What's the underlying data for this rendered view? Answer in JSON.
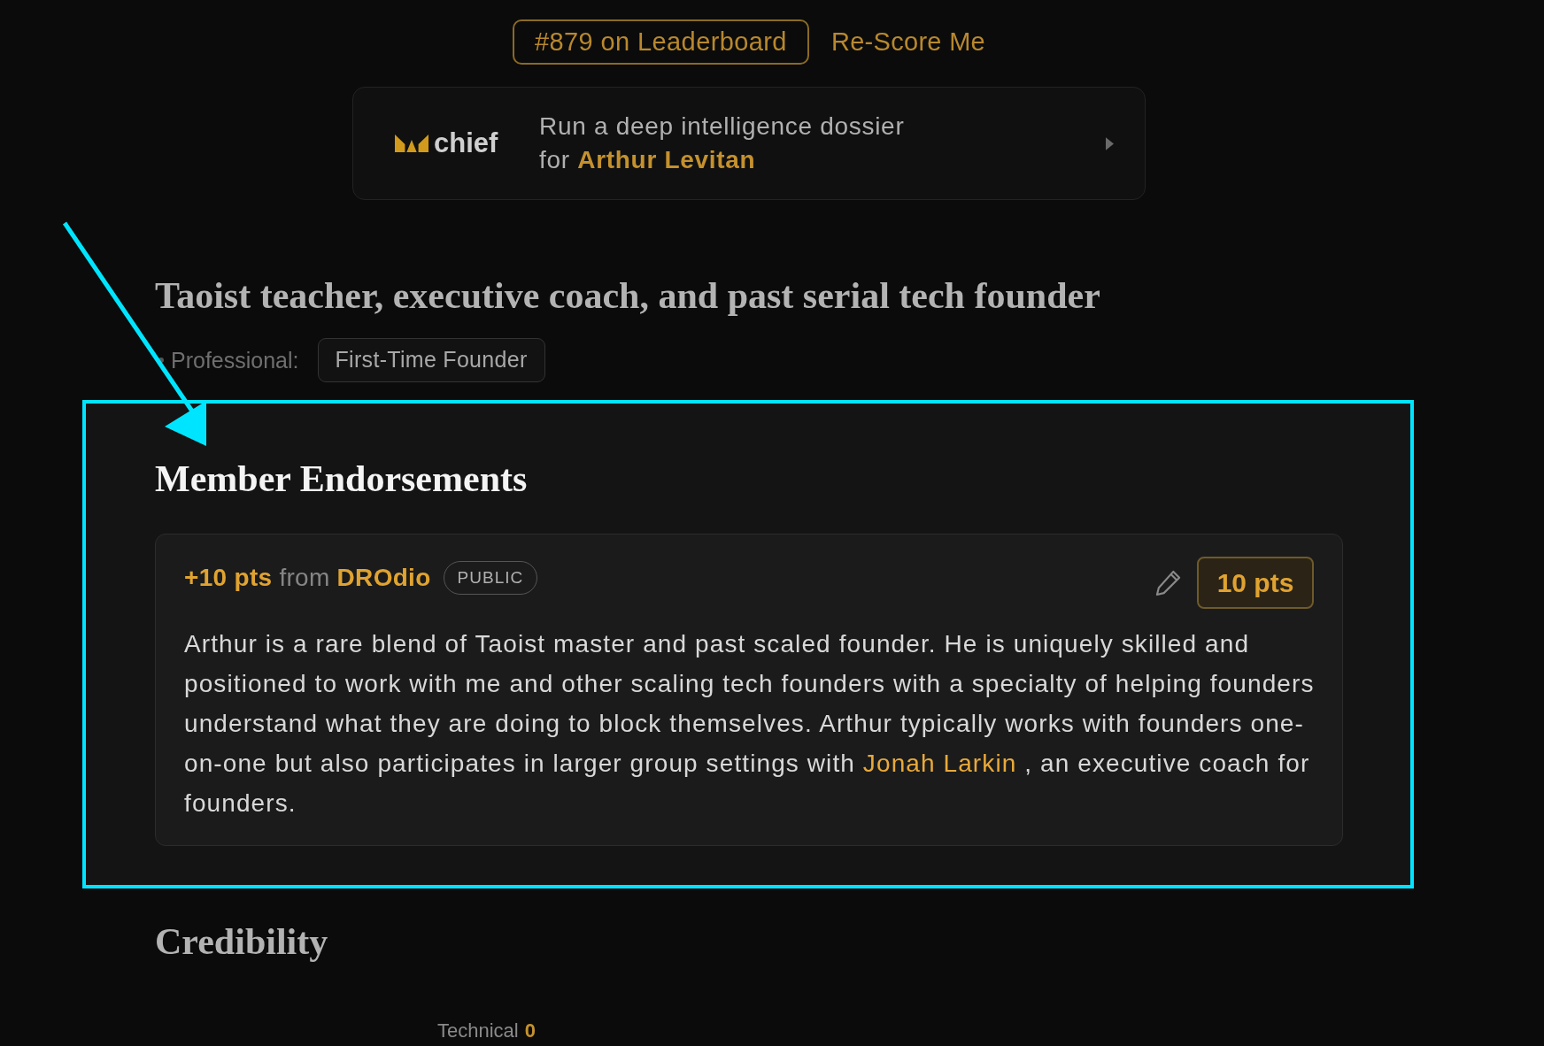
{
  "leaderboard": {
    "rank": "#879 on Leaderboard",
    "rescore": "Re-Score Me"
  },
  "dossier_card": {
    "brand": "chief",
    "lines": [
      "Run a deep intelligence dossier",
      "for **Arthur Levitan**"
    ]
  },
  "headline": "Taoist teacher, executive coach, and past serial tech founder",
  "tag_groups": [
    {
      "label": "Professional:",
      "tags": [
        "First-Time Founder"
      ]
    }
  ],
  "endorsements": {
    "title": "Member Endorsements",
    "highlighted": true,
    "items": [
      {
        "points": "+10 pts",
        "from": "from",
        "author": "DROdio",
        "visibility": "PUBLIC",
        "score_button": "10 pts",
        "body": [
          {
            "kind": "text",
            "text": "Arthur is a rare blend of Taoist master and past scaled founder. He is uniquely skilled and positioned to work with me and other scaling tech founders with a specialty of helping founders understand what they are doing to block themselves. Arthur typically works with founders one-on-one but also participates in larger group settings with "
          },
          {
            "kind": "link",
            "text": "Jonah Larkin"
          },
          {
            "kind": "text",
            "text": " , an executive coach for founders."
          }
        ]
      }
    ]
  },
  "credibility": {
    "title": "Credibility",
    "scores": [
      {
        "label": "Technical",
        "value": "0"
      }
    ]
  }
}
